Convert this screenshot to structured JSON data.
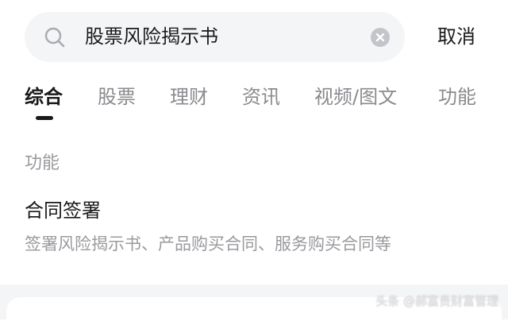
{
  "search": {
    "query": "股票风险揭示书",
    "cancel_label": "取消"
  },
  "tabs": [
    {
      "label": "综合",
      "active": true
    },
    {
      "label": "股票",
      "active": false
    },
    {
      "label": "理财",
      "active": false
    },
    {
      "label": "资讯",
      "active": false
    },
    {
      "label": "视频/图文",
      "active": false
    },
    {
      "label": "功能",
      "active": false
    }
  ],
  "section": {
    "label": "功能"
  },
  "result": {
    "title": "合同签署",
    "description": "签署风险揭示书、产品购买合同、服务购买合同等"
  },
  "watermark": "头条 @郝富贵财富管理",
  "colors": {
    "search_bg": "#f4f5f7",
    "primary_text": "#1a1a1a",
    "secondary_text": "#9a9a9f",
    "inactive_tab": "#8a8a8f"
  }
}
